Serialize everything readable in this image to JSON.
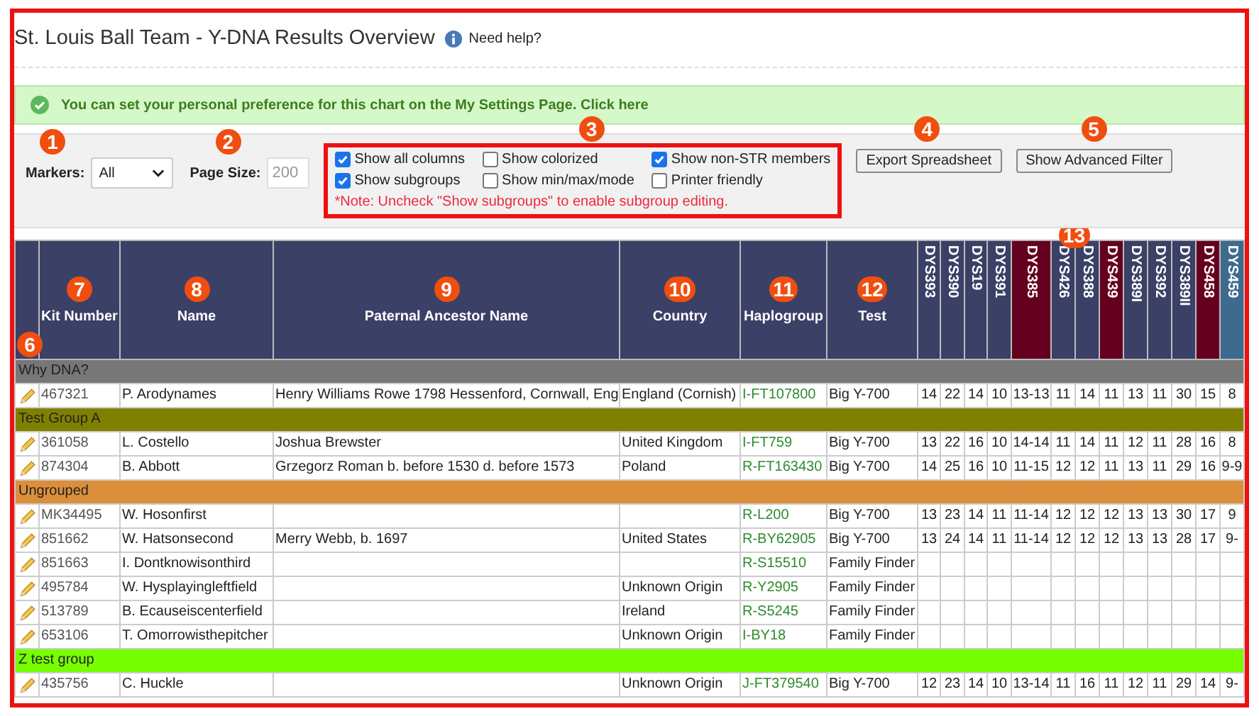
{
  "page": {
    "title": "St. Louis Ball Team - Y-DNA Results Overview",
    "help_link": "Need help?"
  },
  "alert": {
    "text": "You can set your personal preference for this chart on the My Settings Page.",
    "link": "Click here"
  },
  "controls": {
    "markers": {
      "label": "Markers:",
      "value": "All",
      "badge": "1"
    },
    "page_size": {
      "label": "Page Size:",
      "placeholder": "200",
      "badge": "2"
    },
    "options": {
      "badge": "3",
      "items": [
        {
          "label": "Show all columns",
          "checked": true
        },
        {
          "label": "Show colorized",
          "checked": false
        },
        {
          "label": "Show non-STR members",
          "checked": true
        },
        {
          "label": "Show subgroups",
          "checked": true
        },
        {
          "label": "Show min/max/mode",
          "checked": false
        },
        {
          "label": "Printer friendly",
          "checked": false
        }
      ],
      "note": "*Note: Uncheck \"Show subgroups\" to enable subgroup editing."
    },
    "buttons": [
      {
        "label": "Export Spreadsheet",
        "badge": "4"
      },
      {
        "label": "Show Advanced Filter",
        "badge": "5"
      }
    ]
  },
  "table": {
    "edit_badge": "6",
    "markers_badge": "13",
    "columns": [
      {
        "label": "Kit Number",
        "badge": "7"
      },
      {
        "label": "Name",
        "badge": "8"
      },
      {
        "label": "Paternal Ancestor Name",
        "badge": "9"
      },
      {
        "label": "Country",
        "badge": "10"
      },
      {
        "label": "Haplogroup",
        "badge": "11"
      },
      {
        "label": "Test",
        "badge": "12"
      }
    ],
    "marker_columns": [
      {
        "label": "DYS393",
        "color": "#3a4066"
      },
      {
        "label": "DYS390",
        "color": "#3a4066"
      },
      {
        "label": "DYS19",
        "color": "#3a4066"
      },
      {
        "label": "DYS391",
        "color": "#3a4066"
      },
      {
        "label": "DYS385",
        "color": "#650020"
      },
      {
        "label": "DYS426",
        "color": "#3a4066"
      },
      {
        "label": "DYS388",
        "color": "#3a4066"
      },
      {
        "label": "DYS439",
        "color": "#650020"
      },
      {
        "label": "DYS389I",
        "color": "#3a4066"
      },
      {
        "label": "DYS392",
        "color": "#3a4066"
      },
      {
        "label": "DYS389II",
        "color": "#3a4066"
      },
      {
        "label": "DYS458",
        "color": "#650020"
      },
      {
        "label": "DYS459",
        "color": "#3e6a8e"
      }
    ],
    "rows": [
      {
        "kind": "group",
        "label": "Why DNA?",
        "color": "#777777"
      },
      {
        "kind": "member",
        "kit": "467321",
        "name": "P. Arodynames",
        "ancestor": "Henry Williams Rowe 1798 Hessenford, Cornwall, Eng",
        "country": "England (Cornish)",
        "haplogroup": "I-FT107800",
        "test": "Big Y-700",
        "values": [
          "14",
          "22",
          "14",
          "10",
          "13-13",
          "11",
          "14",
          "11",
          "13",
          "11",
          "30",
          "15",
          "8"
        ]
      },
      {
        "kind": "group",
        "label": "Test Group A",
        "color": "#808000"
      },
      {
        "kind": "member",
        "kit": "361058",
        "name": "L. Costello",
        "ancestor": "Joshua Brewster",
        "country": "United Kingdom",
        "haplogroup": "I-FT759",
        "test": "Big Y-700",
        "values": [
          "13",
          "22",
          "16",
          "10",
          "14-14",
          "11",
          "14",
          "11",
          "12",
          "11",
          "28",
          "16",
          "8"
        ]
      },
      {
        "kind": "member",
        "kit": "874304",
        "name": "B. Abbott",
        "ancestor": "Grzegorz Roman b. before 1530 d. before 1573",
        "country": "Poland",
        "haplogroup": "R-FT163430",
        "test": "Big Y-700",
        "values": [
          "14",
          "25",
          "16",
          "10",
          "11-15",
          "12",
          "12",
          "11",
          "13",
          "11",
          "29",
          "16",
          "9-9"
        ]
      },
      {
        "kind": "group",
        "label": "Ungrouped",
        "color": "#dc8f3b"
      },
      {
        "kind": "member",
        "kit": "MK34495",
        "name": "W. Hosonfirst",
        "haplogroup": "R-L200",
        "test": "Big Y-700",
        "values": [
          "13",
          "23",
          "14",
          "11",
          "11-14",
          "12",
          "12",
          "12",
          "13",
          "13",
          "30",
          "17",
          "9"
        ]
      },
      {
        "kind": "member",
        "kit": "851662",
        "name": "W. Hatsonsecond",
        "ancestor": "Merry Webb, b. 1697",
        "country": "United States",
        "haplogroup": "R-BY62905",
        "test": "Big Y-700",
        "values": [
          "13",
          "24",
          "14",
          "11",
          "11-14",
          "12",
          "12",
          "12",
          "13",
          "13",
          "28",
          "17",
          "9-"
        ]
      },
      {
        "kind": "member",
        "kit": "851663",
        "name": "I. Dontknowisonthird",
        "haplogroup": "R-S15510",
        "test": "Family Finder"
      },
      {
        "kind": "member",
        "kit": "495784",
        "name": "W. Hysplayingleftfield",
        "country": "Unknown Origin",
        "haplogroup": "R-Y2905",
        "test": "Family Finder"
      },
      {
        "kind": "member",
        "kit": "513789",
        "name": "B. Ecauseiscenterfield",
        "country": "Ireland",
        "haplogroup": "R-S5245",
        "test": "Family Finder"
      },
      {
        "kind": "member",
        "kit": "653106",
        "name": "T. Omorrowisthepitcher",
        "country": "Unknown Origin",
        "haplogroup": "I-BY18",
        "test": "Family Finder"
      },
      {
        "kind": "group",
        "label": "Z test group",
        "color": "#77ff00"
      },
      {
        "kind": "member",
        "kit": "435756",
        "name": "C. Huckle",
        "country": "Unknown Origin",
        "haplogroup": "J-FT379540",
        "test": "Big Y-700",
        "values": [
          "12",
          "23",
          "14",
          "10",
          "13-14",
          "11",
          "16",
          "11",
          "12",
          "11",
          "29",
          "14",
          "9-"
        ]
      }
    ]
  }
}
